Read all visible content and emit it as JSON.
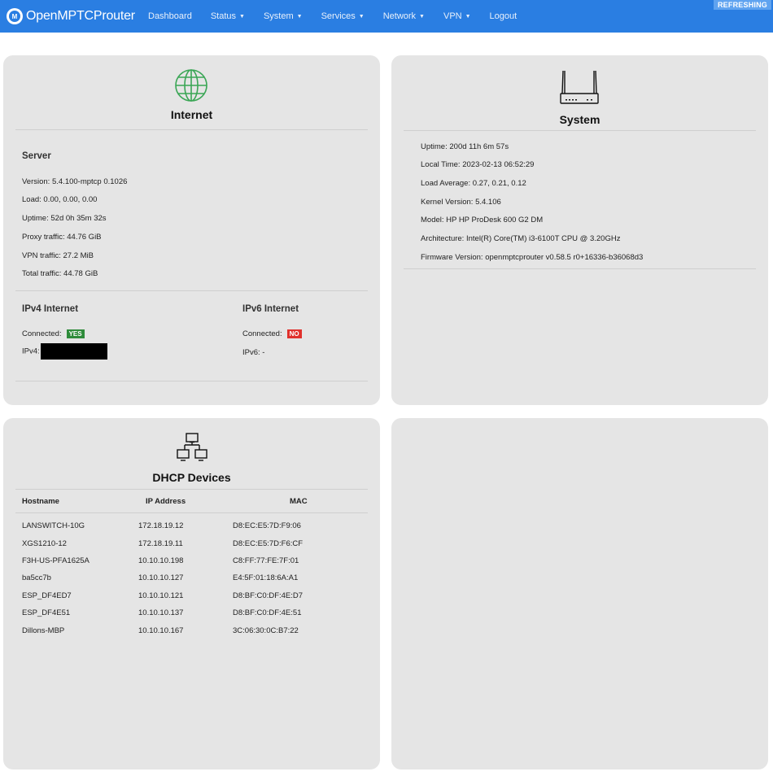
{
  "navbar": {
    "brand": "OpenMPTCProuter",
    "items": [
      {
        "label": "Dashboard",
        "caret": false
      },
      {
        "label": "Status",
        "caret": true
      },
      {
        "label": "System",
        "caret": true
      },
      {
        "label": "Services",
        "caret": true
      },
      {
        "label": "Network",
        "caret": true
      },
      {
        "label": "VPN",
        "caret": true
      },
      {
        "label": "Logout",
        "caret": false
      }
    ],
    "refresh_badge": "REFRESHING"
  },
  "internet": {
    "title": "Internet",
    "icon": "globe-icon",
    "server": {
      "heading": "Server",
      "rows": [
        {
          "label": "Version:",
          "value": "5.4.100-mptcp 0.1026"
        },
        {
          "label": "Load:",
          "value": "0.00, 0.00, 0.00"
        },
        {
          "label": "Uptime:",
          "value": "52d 0h 35m 32s"
        },
        {
          "label": "Proxy traffic:",
          "value": "44.76 GiB"
        },
        {
          "label": "VPN traffic:",
          "value": "27.2 MiB"
        },
        {
          "label": "Total traffic:",
          "value": "44.78 GiB"
        }
      ]
    },
    "ipv4": {
      "heading": "IPv4 Internet",
      "connected_label": "Connected:",
      "connected_value": "YES",
      "ip_label": "IPv4:",
      "ip_value": "",
      "status_color": "#2e8b3a"
    },
    "ipv6": {
      "heading": "IPv6 Internet",
      "connected_label": "Connected:",
      "connected_value": "NO",
      "ip_label": "IPv6:",
      "ip_value": "-",
      "status_color": "#e0312c"
    }
  },
  "system": {
    "title": "System",
    "icon": "router-icon",
    "rows": [
      {
        "label": "Uptime:",
        "value": "200d 11h 6m 57s"
      },
      {
        "label": "Local Time:",
        "value": "2023-02-13 06:52:29"
      },
      {
        "label": "Load Average:",
        "value": "0.27, 0.21, 0.12"
      },
      {
        "label": "Kernel Version:",
        "value": "5.4.106"
      },
      {
        "label": "Model:",
        "value": "HP HP ProDesk 600 G2 DM"
      },
      {
        "label": "Architecture:",
        "value": "Intel(R) Core(TM) i3-6100T CPU @ 3.20GHz"
      },
      {
        "label": "Firmware Version:",
        "value": "openmptcprouter v0.58.5 r0+16336-b36068d3"
      }
    ]
  },
  "dhcp": {
    "title": "DHCP Devices",
    "icon": "network-icon",
    "columns": [
      "Hostname",
      "IP Address",
      "MAC"
    ],
    "rows": [
      [
        "LANSWITCH-10G",
        "172.18.19.12",
        "D8:EC:E5:7D:F9:06"
      ],
      [
        "XGS1210-12",
        "172.18.19.11",
        "D8:EC:E5:7D:F6:CF"
      ],
      [
        "F3H-US-PFA1625A",
        "10.10.10.198",
        "C8:FF:77:FE:7F:01"
      ],
      [
        "ba5cc7b",
        "10.10.10.127",
        "E4:5F:01:18:6A:A1"
      ],
      [
        "ESP_DF4ED7",
        "10.10.10.121",
        "D8:BF:C0:DF:4E:D7"
      ],
      [
        "ESP_DF4E51",
        "10.10.10.137",
        "D8:BF:C0:DF:4E:51"
      ],
      [
        "Dillons-MBP",
        "10.10.10.167",
        "3C:06:30:0C:B7:22"
      ]
    ]
  },
  "colors": {
    "navbar": "#2a7ee2",
    "card": "#e5e5e5",
    "icon_green": "#3aa655"
  }
}
